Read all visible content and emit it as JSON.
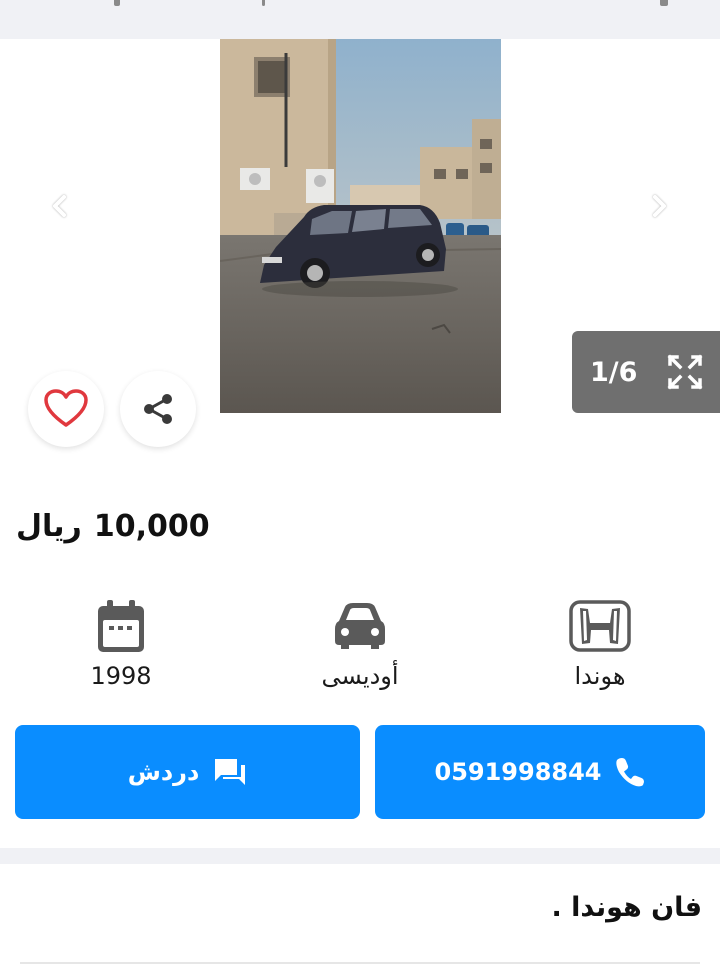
{
  "listing": {
    "image_counter": "1/6",
    "price_amount": "10,000",
    "price_currency": "ريال",
    "description": "فان هوندا ."
  },
  "specs": {
    "make": "هوندا",
    "model": "أوديسى",
    "year": "1998"
  },
  "actions": {
    "chat_label": "دردش",
    "phone_number": "0591998844"
  },
  "icons": {
    "prev": "chevron-left-icon",
    "next": "chevron-right-icon",
    "fullscreen": "fullscreen-icon",
    "favorite": "heart-icon",
    "share": "share-icon",
    "year": "calendar-icon",
    "model": "car-icon",
    "make": "honda-logo-icon",
    "chat": "chat-icon",
    "phone": "phone-icon"
  },
  "colors": {
    "primary": "#0a8dff",
    "favorite": "#e0383e",
    "counter_bg": "#6f6f6f",
    "page_gray": "#f0f1f5"
  }
}
